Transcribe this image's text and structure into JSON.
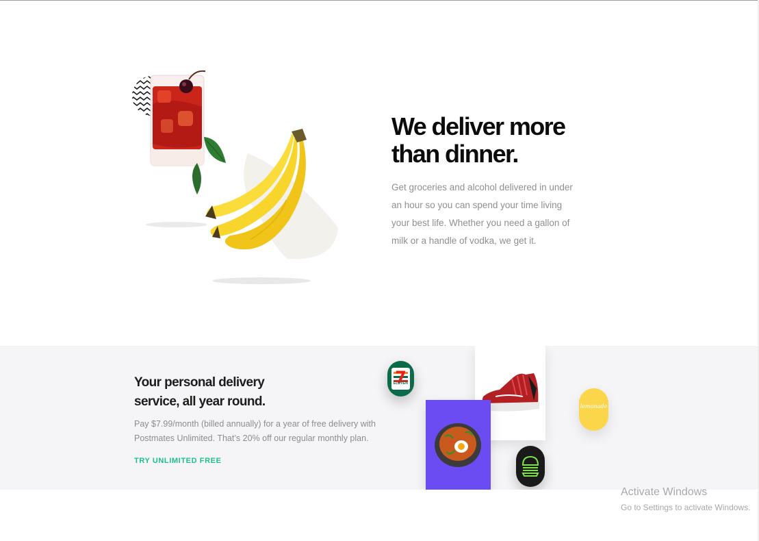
{
  "hero": {
    "title": "We deliver more\nthan dinner.",
    "body": "Get groceries and alcohol delivered in under an hour so you can spend your time living your best life. Whether you need a gallon of milk or a handle of vodka, we get it.",
    "illustration_icons": [
      "cocktail-glass-icon",
      "basil-leaf-icon",
      "banana-bunch-icon",
      "zigzag-pattern-icon"
    ]
  },
  "unlimited": {
    "title": "Your personal delivery service, all year round.",
    "body": "Pay $7.99/month (billed annually) for a year of free delivery with Postmates Unlimited. That’s 20% off our regular monthly plan.",
    "cta_label": "TRY UNLIMITED FREE",
    "merchants": {
      "seven_eleven_glyph": "7",
      "seven_eleven_wordmark": "ELEVEN",
      "lemonade_wordmark": "lemonade"
    },
    "product_icons": [
      "sneaker-icon",
      "stone-bowl-dish-icon",
      "shake-shack-burger-icon"
    ]
  },
  "watermark": {
    "title": "Activate Windows",
    "subtitle": "Go to Settings to activate Windows."
  },
  "colors": {
    "accent_green": "#1fbf85",
    "band_background": "#f5f5f7",
    "seven_eleven_green": "#0b6b48",
    "seven_eleven_red": "#e2231a",
    "seven_eleven_orange": "#f58220",
    "purple_card": "#6a4cf2",
    "lemonade_yellow": "#fbd54a",
    "shakeshack_green": "#7ee34a"
  }
}
